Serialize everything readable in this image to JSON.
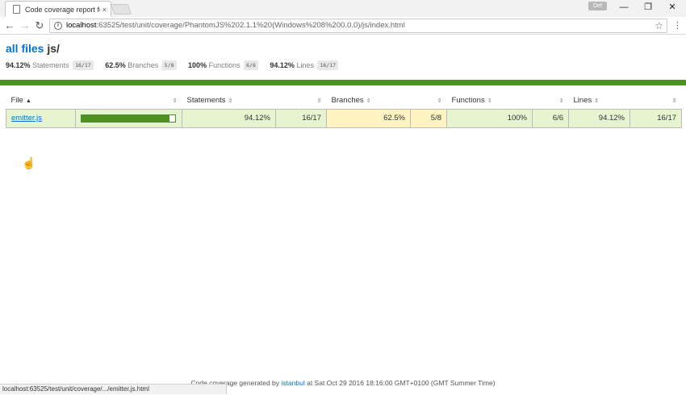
{
  "browser": {
    "tab_title": "Code coverage report fo",
    "tab_close": "×",
    "user_chip": "Def",
    "window_buttons": {
      "minimize": "—",
      "restore": "❐",
      "close": "✕"
    },
    "url_host": "localhost",
    "url_path": ":63525/test/unit/coverage/PhantomJS%202.1.1%20(Windows%208%200.0.0)/js/index.html",
    "status_url": "localhost:63525/test/unit/coverage/.../emitter.js.html"
  },
  "header": {
    "root_link": "all files",
    "dir": "js/"
  },
  "summary": [
    {
      "pct": "94.12%",
      "label": "Statements",
      "fraction": "16/17"
    },
    {
      "pct": "62.5%",
      "label": "Branches",
      "fraction": "5/8"
    },
    {
      "pct": "100%",
      "label": "Functions",
      "fraction": "6/6"
    },
    {
      "pct": "94.12%",
      "label": "Lines",
      "fraction": "16/17"
    }
  ],
  "table": {
    "headers": {
      "file": "File",
      "statements": "Statements",
      "branches": "Branches",
      "functions": "Functions",
      "lines": "Lines"
    },
    "rows": [
      {
        "file": "emitter.js",
        "coverage_fraction": 0.94,
        "statements_pct": "94.12%",
        "statements_frac": "16/17",
        "branches_pct": "62.5%",
        "branches_frac": "5/8",
        "functions_pct": "100%",
        "functions_frac": "6/6",
        "lines_pct": "94.12%",
        "lines_frac": "16/17"
      }
    ]
  },
  "footer": {
    "prefix": "Code coverage generated by",
    "tool": "istanbul",
    "suffix": "at Sat Oct 29 2016 18:16:00 GMT+0100 (GMT Summer Time)"
  },
  "colors": {
    "high": "#e6f5d0",
    "medium": "#fff4c2",
    "status_green": "#4d9221",
    "link": "#0074d9"
  }
}
